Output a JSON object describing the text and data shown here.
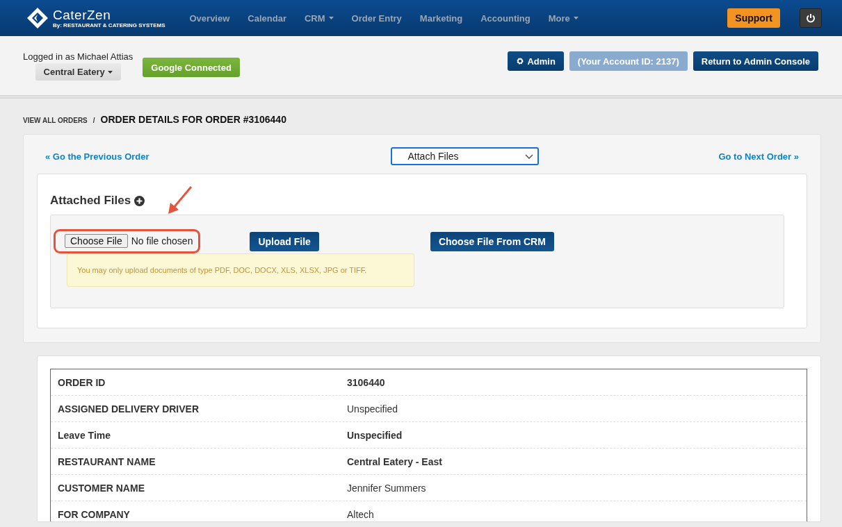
{
  "navbar": {
    "logo": {
      "name": "CaterZen",
      "tagline": "By: RESTAURANT & CATERING SYSTEMS"
    },
    "items": [
      {
        "label": "Overview",
        "dropdown": false
      },
      {
        "label": "Calendar",
        "dropdown": false
      },
      {
        "label": "CRM",
        "dropdown": true
      },
      {
        "label": "Order Entry",
        "dropdown": false
      },
      {
        "label": "Marketing",
        "dropdown": false
      },
      {
        "label": "Accounting",
        "dropdown": false
      },
      {
        "label": "More",
        "dropdown": true
      }
    ],
    "support": "Support"
  },
  "account_bar": {
    "logged_in": "Logged in as Michael Attias",
    "location": "Central Eatery",
    "google": "Google Connected",
    "admin": "Admin",
    "account_id": "(Your Account ID: 2137)",
    "return": "Return to Admin Console"
  },
  "breadcrumb": {
    "parent": "VIEW ALL ORDERS",
    "separator": "/",
    "current": "ORDER DETAILS FOR ORDER #3106440"
  },
  "order_nav": {
    "previous": "« Go the Previous Order",
    "view_select": "Attach Files",
    "next": "Go to Next Order »"
  },
  "attached_files": {
    "title": "Attached Files",
    "file_button": "Choose File",
    "file_status": "No file chosen",
    "upload": "Upload File",
    "from_crm": "Choose File From CRM",
    "notice": "You may only upload documents of type PDF, DOC, DOCX, XLS, XLSX, JPG or TIFF."
  },
  "details": [
    {
      "label": "ORDER ID",
      "value": "3106440",
      "emphasized": true
    },
    {
      "label": "ASSIGNED DELIVERY DRIVER",
      "value": "Unspecified",
      "emphasized": false
    },
    {
      "label": "Leave Time",
      "value": "Unspecified",
      "emphasized": true
    },
    {
      "label": "RESTAURANT NAME",
      "value": "Central Eatery - East",
      "emphasized": true
    },
    {
      "label": "CUSTOMER NAME",
      "value": "Jennifer Summers",
      "emphasized": false
    },
    {
      "label": "FOR COMPANY",
      "value": "Altech",
      "emphasized": false
    }
  ]
}
